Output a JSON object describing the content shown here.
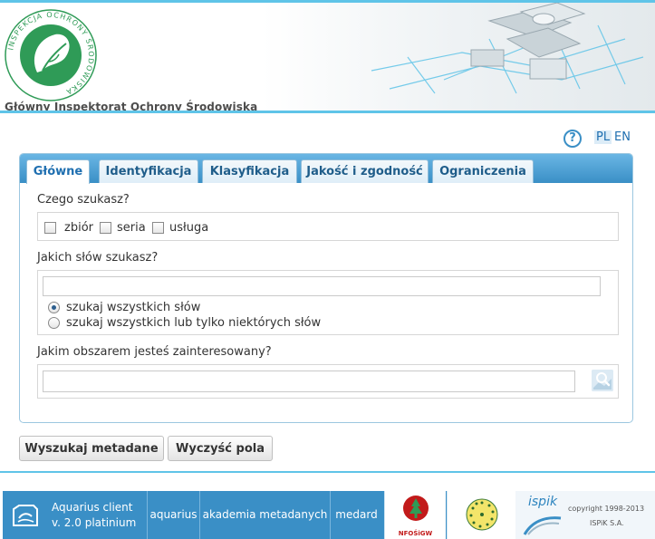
{
  "header": {
    "org_name": "Główny Inspektorat Ochrony Środowiska",
    "logo_ring_text": "INSPEKCJA OCHRONY ŚRODOWISKA",
    "accent_color": "#5fc4e8"
  },
  "util": {
    "help_icon": "question-circle-icon",
    "help_glyph": "?",
    "lang_pl": "PL",
    "lang_en": "EN"
  },
  "tabs": [
    {
      "label": "Główne",
      "active": true
    },
    {
      "label": "Identyfikacja",
      "active": false
    },
    {
      "label": "Klasyfikacja",
      "active": false
    },
    {
      "label": "Jakość i zgodność",
      "active": false
    },
    {
      "label": "Ograniczenia",
      "active": false
    }
  ],
  "form": {
    "what_label": "Czego szukasz?",
    "types": [
      "zbiór",
      "seria",
      "usługa"
    ],
    "words_label": "Jakich słów szukasz?",
    "words_value": "",
    "radio_all": "szukaj wszystkich słów",
    "radio_any": "szukaj wszystkich lub tylko niektórych słów",
    "area_label": "Jakim obszarem jesteś zainteresowany?",
    "area_value": "",
    "map_icon": "map-search-icon"
  },
  "buttons": {
    "search": "Wyszukaj metadane",
    "clear": "Wyczyść pola"
  },
  "footer": {
    "app_name": "Aquarius client",
    "app_version": "v. 2.0 platinium",
    "links": [
      "aquarius",
      "akademia metadanych",
      "medard"
    ],
    "nfos_label": "NFOŚiGW",
    "inspire_logo": "inspire-logo-icon",
    "ispik_name": "ispik",
    "copyright": "copyright 1998-2013",
    "company": "ISPiK S.A.",
    "bg_color": "#3a8fc6"
  }
}
